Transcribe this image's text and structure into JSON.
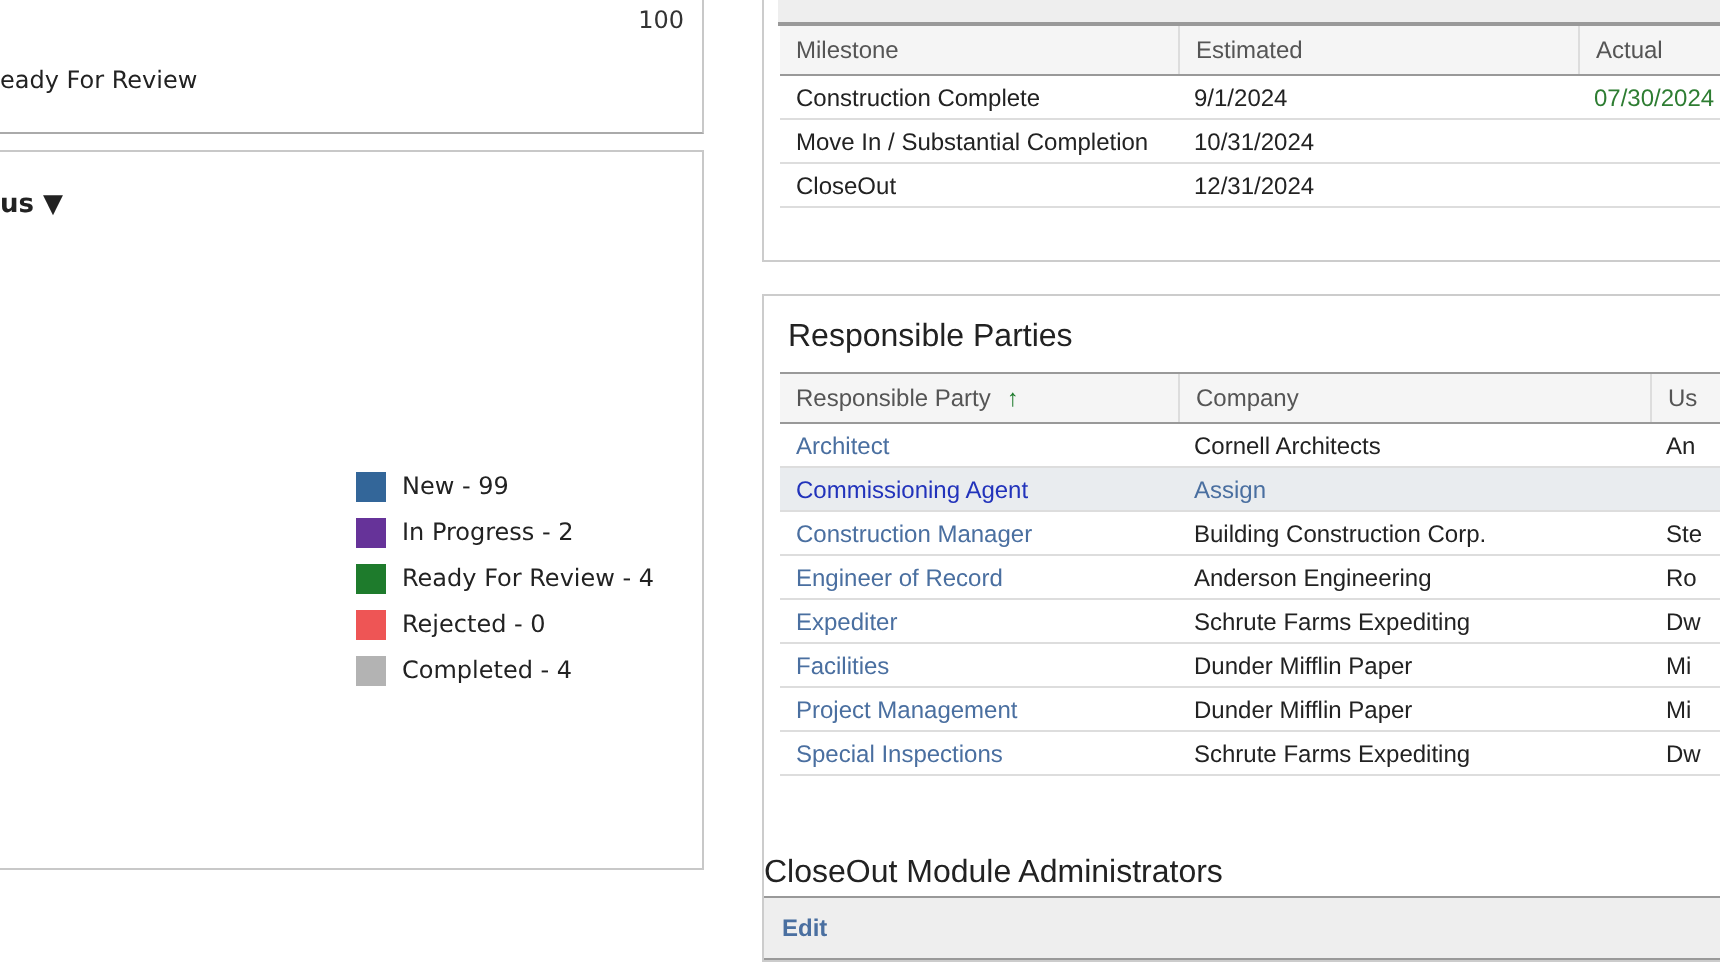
{
  "summary_panel": {
    "value": "100",
    "status": "eady For Review"
  },
  "status_panel": {
    "title": "us ▼",
    "legend": [
      {
        "label": "New - 99",
        "color": "#336699"
      },
      {
        "label": "In Progress - 2",
        "color": "#663399"
      },
      {
        "label": "Ready For Review - 4",
        "color": "#1e7b2c"
      },
      {
        "label": "Rejected - 0",
        "color": "#ee5555"
      },
      {
        "label": "Completed - 4",
        "color": "#b3b3b3"
      }
    ]
  },
  "milestones": {
    "columns": [
      "Milestone",
      "Estimated",
      "Actual"
    ],
    "rows": [
      {
        "milestone": "Construction Complete",
        "estimated": "9/1/2024",
        "actual": "07/30/2024"
      },
      {
        "milestone": "Move In / Substantial Completion",
        "estimated": "10/31/2024",
        "actual": ""
      },
      {
        "milestone": "CloseOut",
        "estimated": "12/31/2024",
        "actual": ""
      }
    ]
  },
  "responsible_parties": {
    "title": "Responsible Parties",
    "columns": [
      "Responsible Party",
      "Company",
      "Us"
    ],
    "sort_icon": "↑",
    "rows": [
      {
        "party": "Architect",
        "company": "Cornell Architects",
        "company_is_link": false,
        "column_3": "An",
        "selected": false
      },
      {
        "party": "Commissioning Agent",
        "company": "Assign",
        "company_is_link": true,
        "column_3": "",
        "selected": true
      },
      {
        "party": "Construction Manager",
        "company": "Building Construction Corp.",
        "company_is_link": false,
        "column_3": "Ste",
        "selected": false
      },
      {
        "party": "Engineer of Record",
        "company": "Anderson Engineering",
        "company_is_link": false,
        "column_3": "Ro",
        "selected": false
      },
      {
        "party": "Expediter",
        "company": "Schrute Farms Expediting",
        "company_is_link": false,
        "column_3": "Dw",
        "selected": false
      },
      {
        "party": "Facilities",
        "company": "Dunder Mifflin Paper",
        "company_is_link": false,
        "column_3": "Mi",
        "selected": false
      },
      {
        "party": "Project Management",
        "company": "Dunder Mifflin Paper",
        "company_is_link": false,
        "column_3": "Mi",
        "selected": false
      },
      {
        "party": "Special Inspections",
        "company": "Schrute Farms Expediting",
        "company_is_link": false,
        "column_3": "Dw",
        "selected": false
      }
    ]
  },
  "administrators": {
    "title": "CloseOut Module Administrators",
    "edit": "Edit"
  }
}
